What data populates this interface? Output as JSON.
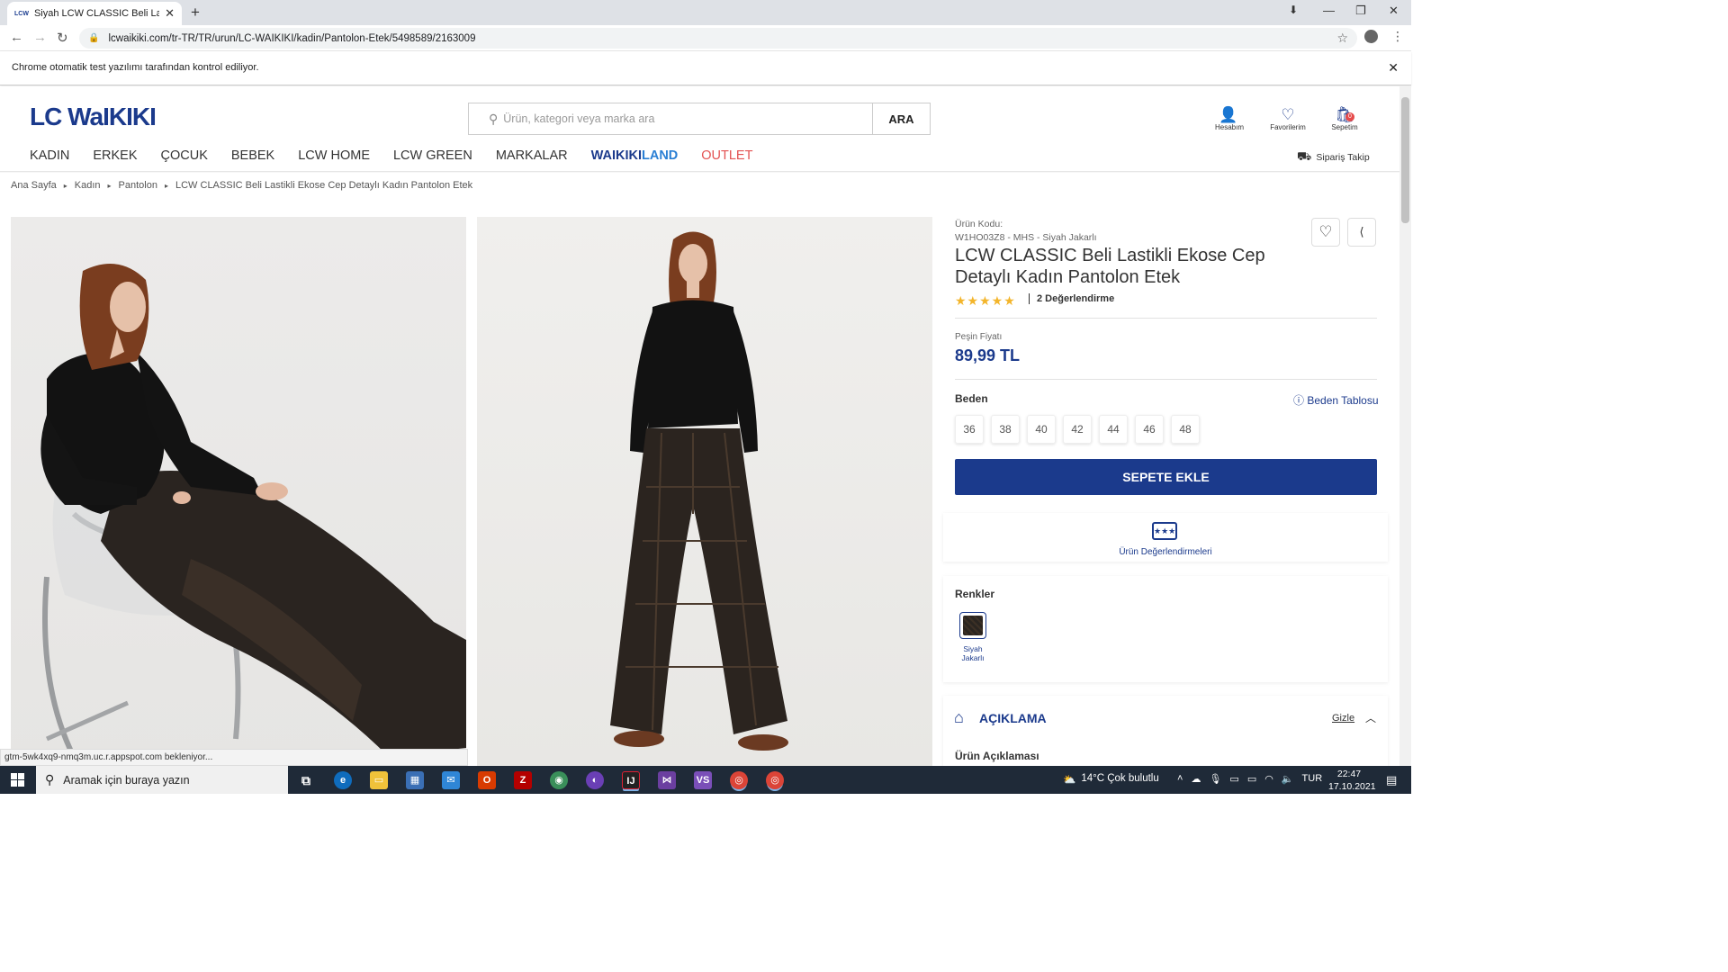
{
  "browser": {
    "tab_favicon": "LCW",
    "tab_title": "Siyah LCW CLASSIC Beli Lastikli E",
    "url": "lcwaikiki.com/tr-TR/TR/urun/LC-WAIKIKI/kadin/Pantolon-Etek/5498589/2163009",
    "infobar": "Chrome otomatik test yazılımı tarafından kontrol ediliyor."
  },
  "header": {
    "logo": "LC WaIKIKI",
    "search_placeholder": "Ürün, kategori veya marka ara",
    "search_button": "ARA",
    "account": "Hesabım",
    "favorites": "Favorilerim",
    "cart": "Sepetim",
    "cart_count": "0",
    "order_track": "Sipariş Takip",
    "nav": [
      "KADIN",
      "ERKEK",
      "ÇOCUK",
      "BEBEK",
      "LCW HOME",
      "LCW GREEN",
      "MARKALAR"
    ],
    "nav_waikiki": "WAIKIKI",
    "nav_land": "LAND",
    "nav_outlet": "OUTLET"
  },
  "breadcrumb": [
    "Ana Sayfa",
    "Kadın",
    "Pantolon",
    "LCW CLASSIC Beli Lastikli Ekose Cep Detaylı Kadın Pantolon Etek"
  ],
  "product": {
    "code_label": "Ürün Kodu:",
    "code": "W1HO03Z8 - MHS - Siyah Jakarlı",
    "title": "LCW CLASSIC Beli Lastikli Ekose Cep Detaylı Kadın Pantolon Etek",
    "rating_stars": 5,
    "rating_count": "2 Değerlendirme",
    "price_label": "Peşin Fiyatı",
    "price": "89,99 TL",
    "size_label": "Beden",
    "size_table": "Beden Tablosu",
    "sizes": [
      "36",
      "38",
      "40",
      "42",
      "44",
      "46",
      "48"
    ],
    "add_to_cart": "SEPETE EKLE",
    "reviews_link": "Ürün Değerlendirmeleri",
    "colors_label": "Renkler",
    "color_name": "Siyah Jakarlı",
    "description_title": "AÇIKLAMA",
    "hide": "Gizle",
    "description_sub": "Ürün Açıklaması"
  },
  "status_text": "gtm-5wk4xq9-nmq3m.uc.r.appspot.com bekleniyor...",
  "taskbar": {
    "search_placeholder": "Aramak için buraya yazın",
    "weather": "14°C  Çok bulutlu",
    "lang": "TUR",
    "time": "22:47",
    "date": "17.10.2021"
  },
  "colors": {
    "brand": "#1b3a8c",
    "outlet": "#e35252",
    "star": "#f3b52b"
  }
}
